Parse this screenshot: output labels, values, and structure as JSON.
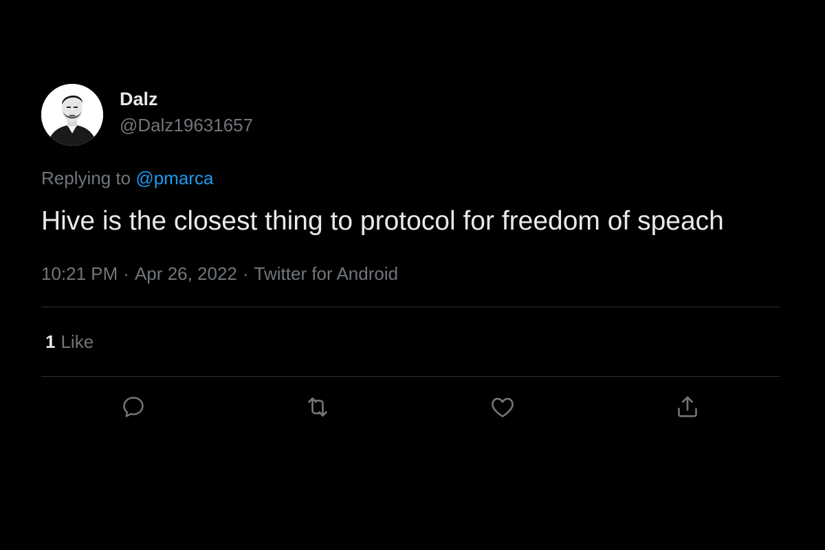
{
  "tweet": {
    "display_name": "Dalz",
    "handle": "@Dalz19631657",
    "replying_prefix": "Replying to",
    "replying_mention": "@pmarca",
    "text": "Hive is the closest thing to protocol for freedom of speach",
    "time": "10:21 PM",
    "separator": "·",
    "date": "Apr 26, 2022",
    "source": "Twitter for Android",
    "like_count": "1",
    "like_label": "Like"
  },
  "actions": [
    {
      "name": "reply-icon"
    },
    {
      "name": "retweet-icon"
    },
    {
      "name": "like-icon"
    },
    {
      "name": "share-icon"
    }
  ],
  "colors": {
    "background": "#000000",
    "primary_text": "#e7e9ea",
    "secondary_text": "#71767b",
    "mention": "#1d9bf0",
    "divider": "#2f3336"
  }
}
